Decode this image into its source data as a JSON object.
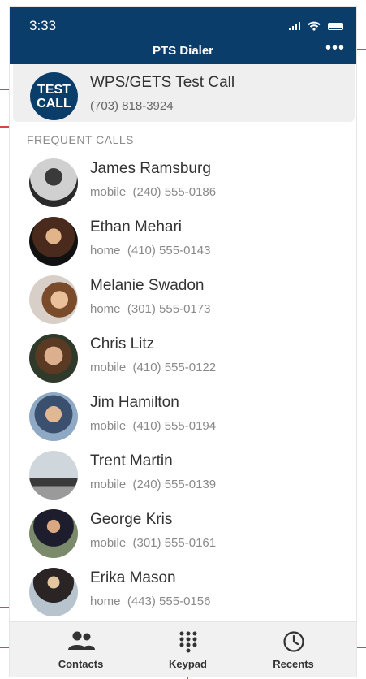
{
  "status_bar": {
    "time": "3:33"
  },
  "header": {
    "title": "PTS Dialer",
    "more_label": "•••"
  },
  "test_call": {
    "avatar_line1": "TEST",
    "avatar_line2": "CALL",
    "name": "WPS/GETS Test Call",
    "phone": "(703) 818-3924"
  },
  "section": {
    "title": "FREQUENT CALLS"
  },
  "contacts": [
    {
      "name": "James Ramsburg",
      "type": "mobile",
      "phone": "(240) 555-0186"
    },
    {
      "name": "Ethan Mehari",
      "type": "home",
      "phone": "(410) 555-0143"
    },
    {
      "name": "Melanie Swadon",
      "type": "home",
      "phone": "(301) 555-0173"
    },
    {
      "name": "Chris Litz",
      "type": "mobile",
      "phone": "(410) 555-0122"
    },
    {
      "name": "Jim Hamilton",
      "type": "mobile",
      "phone": "(410) 555-0194"
    },
    {
      "name": "Trent Martin",
      "type": "mobile",
      "phone": "(240) 555-0139"
    },
    {
      "name": "George Kris",
      "type": "mobile",
      "phone": "(301) 555-0161"
    },
    {
      "name": "Erika Mason",
      "type": "home",
      "phone": "(443) 555-0156"
    }
  ],
  "tabs": [
    {
      "label": "Contacts",
      "icon": "contacts-icon"
    },
    {
      "label": "Keypad",
      "icon": "keypad-icon"
    },
    {
      "label": "Recents",
      "icon": "clock-icon"
    }
  ],
  "colors": {
    "brand": "#0b3d6b",
    "callout": "#d9434a"
  }
}
